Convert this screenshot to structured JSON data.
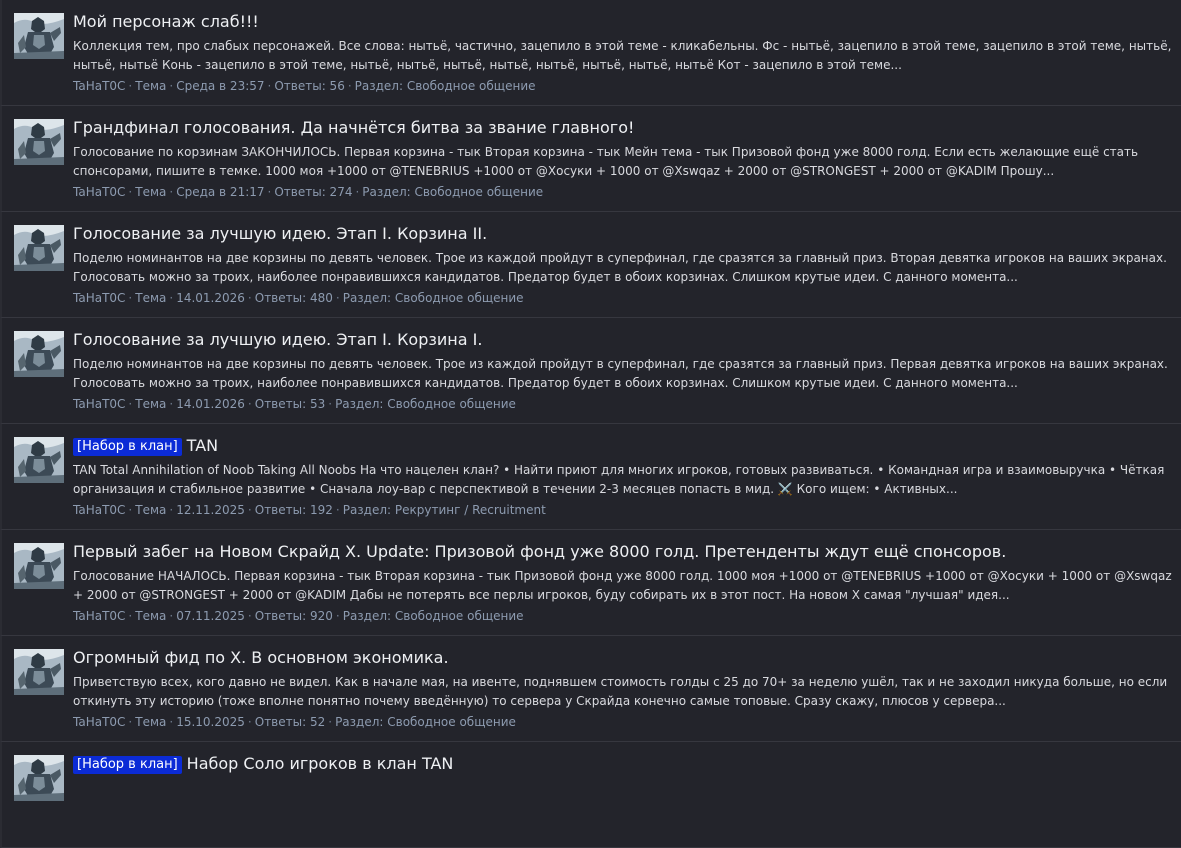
{
  "results": [
    {
      "badge": "",
      "title": "Мой персонаж слаб!!!",
      "snippet": "Коллекция тем, про слабых персонажей. Все слова: нытьё, частично, зацепило в этой теме - кликабельны. Фс - нытьё, зацепило в этой теме, зацепило в этой теме, нытьё, нытьё, нытьё Конь - зацепило в этой теме, нытьё, нытьё, нытьё, нытьё, нытьё, нытьё, нытьё, нытьё Кот - зацепило в этой теме...",
      "author": "TaHaT0C",
      "type": "Тема",
      "date": "Среда в 23:57",
      "replies": "Ответы: 56",
      "forum": "Раздел: Свободное общение"
    },
    {
      "badge": "",
      "title": "Грандфинал голосования. Да начнётся битва за звание главного!",
      "snippet": "Голосование по корзинам ЗАКОНЧИЛОСЬ. Первая корзина - тык Вторая корзина - тык Мейн тема - тык Призовой фонд уже 8000 голд. Если есть желающие ещё стать спонсорами, пишите в темке. 1000 моя +1000 от @TENEBRIUS +1000 от @Хосуки + 1000 от @Xswqaz + 2000 от @STRONGEST + 2000 от @KADIM Прошу...",
      "author": "TaHaT0C",
      "type": "Тема",
      "date": "Среда в 21:17",
      "replies": "Ответы: 274",
      "forum": "Раздел: Свободное общение"
    },
    {
      "badge": "",
      "title": "Голосование за лучшую идею. Этап I. Корзина II.",
      "snippet": "Поделю номинантов на две корзины по девять человек. Трое из каждой пройдут в суперфинал, где сразятся за главный приз. Вторая девятка игроков на ваших экранах. Голосовать можно за троих, наиболее понравившихся кандидатов. Предатор будет в обоих корзинах. Слишком крутые идеи. С данного момента...",
      "author": "TaHaT0C",
      "type": "Тема",
      "date": "14.01.2026",
      "replies": "Ответы: 480",
      "forum": "Раздел: Свободное общение"
    },
    {
      "badge": "",
      "title": "Голосование за лучшую идею. Этап I. Корзина I.",
      "snippet": "Поделю номинантов на две корзины по девять человек. Трое из каждой пройдут в суперфинал, где сразятся за главный приз. Первая девятка игроков на ваших экранах. Голосовать можно за троих, наиболее понравившихся кандидатов. Предатор будет в обоих корзинах. Слишком крутые идеи. С данного момента...",
      "author": "TaHaT0C",
      "type": "Тема",
      "date": "14.01.2026",
      "replies": "Ответы: 53",
      "forum": "Раздел: Свободное общение"
    },
    {
      "badge": "[Набор в клан]",
      "title": "TAN",
      "snippet": "TAN Total Annihilation of Noob Taking All Noobs На что нацелен клан? • Найти приют для многих игроков, готовых развиваться. • Командная игра и взаимовыручка • Чёткая организация и стабильное развитие • Сначала лоу-вар с перспективой в течении 2-3 месяцев попасть в мид. ⚔️ Кого ищем: • Активных...",
      "author": "TaHaT0C",
      "type": "Тема",
      "date": "12.11.2025",
      "replies": "Ответы: 192",
      "forum": "Раздел: Рекрутинг / Recruitment"
    },
    {
      "badge": "",
      "title": "Первый забег на Новом Скрайд X. Update: Призовой фонд уже 8000 голд. Претенденты ждут ещё спонсоров.",
      "snippet": "Голосование НАЧАЛОСЬ. Первая корзина - тык Вторая корзина - тык Призовой фонд уже 8000 голд. 1000 моя +1000 от @TENEBRIUS +1000 от @Хосуки + 1000 от @Xswqaz + 2000 от @STRONGEST + 2000 от @KADIM Дабы не потерять все перлы игроков, буду собирать их в этот пост. На новом X самая \"лучшая\" идея...",
      "author": "TaHaT0C",
      "type": "Тема",
      "date": "07.11.2025",
      "replies": "Ответы: 920",
      "forum": "Раздел: Свободное общение"
    },
    {
      "badge": "",
      "title": "Огромный фид по X. В основном экономика.",
      "snippet": "Приветствую всех, кого давно не видел. Как в начале мая, на ивенте, поднявшем стоимость голды с 25 до 70+ за неделю ушёл, так и не заходил никуда больше, но если откинуть эту историю (тоже вполне понятно почему введённую) то сервера у Скрайда конечно самые топовые. Сразу скажу, плюсов у сервера...",
      "author": "TaHaT0C",
      "type": "Тема",
      "date": "15.10.2025",
      "replies": "Ответы: 52",
      "forum": "Раздел: Свободное общение"
    },
    {
      "badge": "[Набор в клан]",
      "title": "Набор Соло игроков в клан TAN",
      "snippet": "",
      "author": "",
      "type": "",
      "date": "",
      "replies": "",
      "forum": ""
    }
  ]
}
